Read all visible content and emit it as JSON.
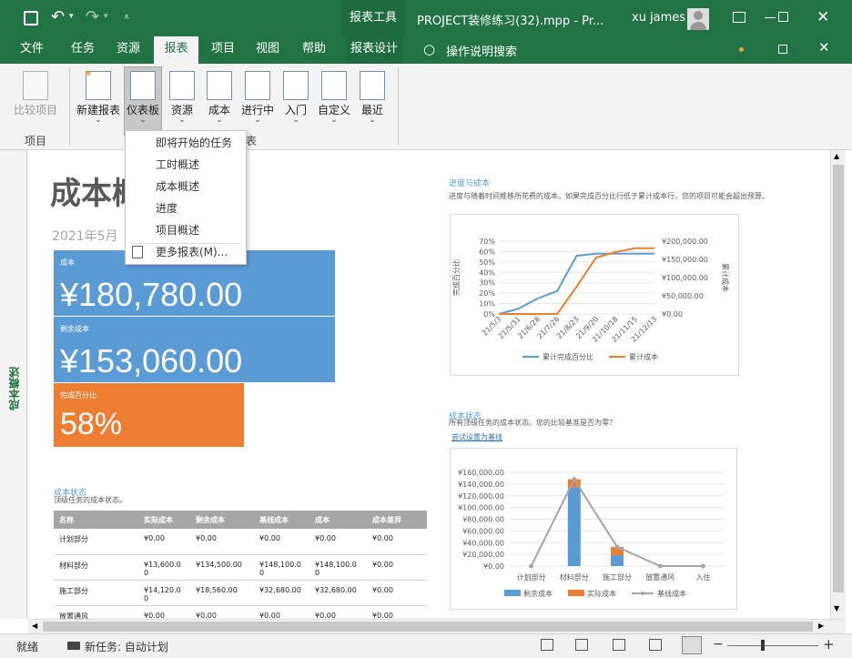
{
  "titlebar": {
    "context_tab": "报表工具",
    "file_title": "PROJECT装修练习(32).mpp  -  Pr...",
    "user_name": "xu james",
    "qat": {
      "save_icon": "save-icon",
      "undo_icon": "undo-icon",
      "redo_icon": "redo-icon"
    }
  },
  "tabs": [
    {
      "label": "文件"
    },
    {
      "label": "任务"
    },
    {
      "label": "资源"
    },
    {
      "label": "报表"
    },
    {
      "label": "项目"
    },
    {
      "label": "视图"
    },
    {
      "label": "帮助"
    },
    {
      "label": "报表设计"
    }
  ],
  "tell_me": "操作说明搜索",
  "ribbon": {
    "compare_label": "比较项目",
    "group_project": "项目",
    "group_reports_tail": "表",
    "buttons": [
      {
        "label": "新建报表"
      },
      {
        "label": "仪表板"
      },
      {
        "label": "资源"
      },
      {
        "label": "成本"
      },
      {
        "label": "进行中"
      },
      {
        "label": "入门"
      },
      {
        "label": "自定义"
      },
      {
        "label": "最近"
      }
    ]
  },
  "dropdown": {
    "items": [
      "即将开始的任务",
      "工时概述",
      "成本概述",
      "进度",
      "项目概述"
    ],
    "more": "更多报表(M)..."
  },
  "sidebar_label": "成本概述",
  "report": {
    "title": "成本概",
    "date": "2021年5月",
    "kpis": [
      {
        "label": "成本",
        "value": "¥180,780.00",
        "color": "#5b9bd5"
      },
      {
        "label": "剩余成本",
        "value": "¥153,060.00",
        "color": "#5b9bd5"
      },
      {
        "label": "完成百分比",
        "value": "58%",
        "color": "#ed7d31"
      }
    ],
    "cost_status_title": "成本状态",
    "cost_status_desc": "顶级任务的成本状态。",
    "table": {
      "headers": [
        "名称",
        "实际成本",
        "剩余成本",
        "基线成本",
        "成本",
        "成本差异"
      ],
      "rows": [
        [
          "计划部分",
          "¥0.00",
          "¥0.00",
          "¥0.00",
          "¥0.00",
          "¥0.00"
        ],
        [
          "材料部分",
          "¥13,600.0\n0",
          "¥134,500.00",
          "¥148,100.0\n0",
          "¥148,100.0\n0",
          "¥0.00"
        ],
        [
          "施工部分",
          "¥14,120.0\n0",
          "¥18,560.00",
          "¥32,680.00",
          "¥32,680.00",
          "¥0.00"
        ],
        [
          "放置通风",
          "¥0.00",
          "¥0.00",
          "¥0.00",
          "¥0.00",
          "¥0.00"
        ]
      ]
    },
    "progress_title": "进度与成本",
    "progress_desc": "进度与随着时间推移所花费的成本。如果完成百分比行低于累计成本行，您的项目可能会超出预算。",
    "status_title": "成本状态",
    "status_desc": "所有顶级任务的成本状态。您的比较基准是否为零？",
    "baseline_link": "尝试设置为基线"
  },
  "chart_data": [
    {
      "type": "line",
      "x": [
        "21/5/3",
        "21/5/31",
        "21/6/28",
        "21/7/26",
        "21/8/23",
        "21/9/20",
        "21/10/18",
        "21/11/15",
        "21/12/13"
      ],
      "series": [
        {
          "name": "累计完成百分比",
          "axis": "left",
          "color": "#5b9bd5",
          "values": [
            0,
            5,
            15,
            22,
            56,
            58,
            58,
            58,
            58
          ]
        },
        {
          "name": "累计成本",
          "axis": "right",
          "color": "#ed7d31",
          "values": [
            0,
            0,
            0,
            0,
            75000,
            155000,
            170000,
            180780,
            180780
          ]
        }
      ],
      "left_ticks": [
        "0%",
        "10%",
        "20%",
        "30%",
        "40%",
        "50%",
        "60%",
        "70%"
      ],
      "right_ticks": [
        "¥0.00",
        "¥50,000.00",
        "¥100,000.00",
        "¥150,000.00",
        "¥200,000.00"
      ],
      "ylabel_left": "完成百分比",
      "ylabel_right": "累计成本",
      "ylim_left": [
        0,
        70
      ],
      "ylim_right": [
        0,
        200000
      ],
      "grid": true,
      "legend": "bottom"
    },
    {
      "type": "bar",
      "categories": [
        "计划部分",
        "材料部分",
        "施工部分",
        "放置通风",
        "入住"
      ],
      "series": [
        {
          "name": "剩余成本",
          "color": "#5b9bd5",
          "values": [
            0,
            134500,
            18560,
            0,
            0
          ]
        },
        {
          "name": "实际成本",
          "color": "#ed7d31",
          "values": [
            0,
            13600,
            14120,
            0,
            0
          ]
        },
        {
          "name": "基线成本",
          "color": "#a5a5a5",
          "kind": "line",
          "values": [
            0,
            148100,
            32680,
            0,
            0
          ]
        }
      ],
      "y_ticks": [
        "¥0.00",
        "¥20,000.00",
        "¥40,000.00",
        "¥60,000.00",
        "¥80,000.00",
        "¥100,000.00",
        "¥120,000.00",
        "¥140,000.00",
        "¥160,000.00"
      ],
      "ylim": [
        0,
        160000
      ],
      "stacked": true,
      "grid": true,
      "legend": "bottom"
    }
  ],
  "status": {
    "ready": "就绪",
    "new_task": "新任务: 自动计划"
  }
}
